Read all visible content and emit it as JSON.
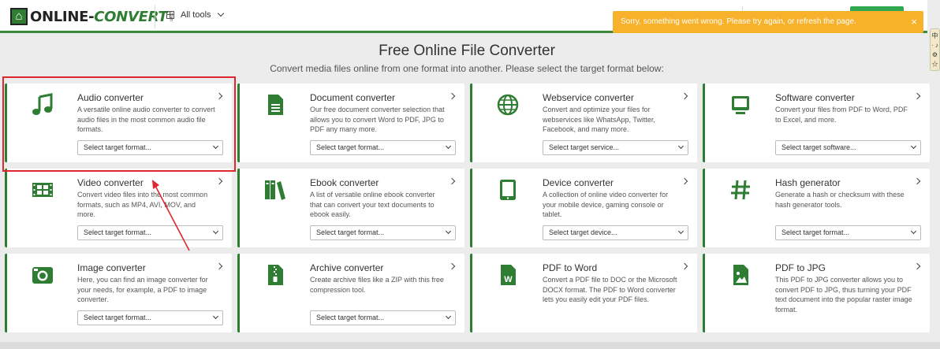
{
  "header": {
    "logo_text_a": "ONLINE-",
    "logo_text_b": "CONVERT",
    "logo_com": ".com",
    "all_tools_label": "All tools"
  },
  "toast": {
    "message": "Sorry, something went wrong. Please try again, or refresh the page.",
    "close": "×"
  },
  "side_widget": {
    "text": "中 · ♪ ⚙ ☆"
  },
  "main": {
    "title": "Free Online File Converter",
    "subtitle": "Convert media files online from one format into another. Please select the target format below:"
  },
  "cards": [
    {
      "title": "Audio converter",
      "desc": "A versatile online audio converter to convert audio files in the most common audio file formats.",
      "select": "Select target format...",
      "icon": "music-note-icon"
    },
    {
      "title": "Document converter",
      "desc": "Our free document converter selection that allows you to convert Word to PDF, JPG to PDF any many more.",
      "select": "Select target format...",
      "icon": "document-icon"
    },
    {
      "title": "Webservice converter",
      "desc": "Convert and optimize your files for webservices like WhatsApp, Twitter, Facebook, and many more.",
      "select": "Select target service...",
      "icon": "globe-icon"
    },
    {
      "title": "Software converter",
      "desc": "Convert your files from PDF to Word, PDF to Excel, and more.",
      "select": "Select target software...",
      "icon": "monitor-icon"
    },
    {
      "title": "Video converter",
      "desc": "Convert video files into the most common formats, such as MP4, AVI, MOV, and more.",
      "select": "Select target format...",
      "icon": "film-icon"
    },
    {
      "title": "Ebook converter",
      "desc": "A list of versatile online ebook converter that can convert your text documents to ebook easily.",
      "select": "Select target format...",
      "icon": "books-icon"
    },
    {
      "title": "Device converter",
      "desc": "A collection of online video converter for your mobile device, gaming console or tablet.",
      "select": "Select target device...",
      "icon": "tablet-icon"
    },
    {
      "title": "Hash generator",
      "desc": "Generate a hash or checksum with these hash generator tools.",
      "select": "Select target format...",
      "icon": "hash-icon"
    },
    {
      "title": "Image converter",
      "desc": "Here, you can find an image converter for your needs, for example, a PDF to image converter.",
      "select": "Select target format...",
      "icon": "camera-icon"
    },
    {
      "title": "Archive converter",
      "desc": "Create archive files like a ZIP with this free compression tool.",
      "select": "Select target format...",
      "icon": "archive-icon"
    },
    {
      "title": "PDF to Word",
      "desc": "Convert a PDF file to DOC or the Microsoft DOCX format. The PDF to Word converter lets you easily edit your PDF files.",
      "select": "",
      "icon": "word-file-icon"
    },
    {
      "title": "PDF to JPG",
      "desc": "This PDF to JPG converter allows you to convert PDF to JPG, thus turning your PDF text document into the popular raster image format.",
      "select": "",
      "icon": "image-file-icon"
    }
  ],
  "colors": {
    "accent": "#2f7d32",
    "toast": "#f7b12a",
    "annotation": "#e0262e"
  }
}
